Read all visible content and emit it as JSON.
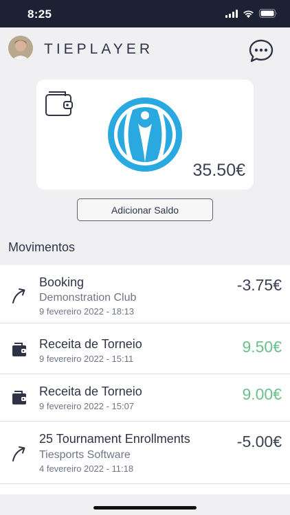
{
  "status_bar": {
    "time": "8:25"
  },
  "header": {
    "title": "TIEPLAYER"
  },
  "wallet": {
    "balance": "35.50€"
  },
  "add_balance_label": "Adicionar Saldo",
  "section_title": "Movimentos",
  "transactions": [
    {
      "icon": "arrow-up-right-icon",
      "title": "Booking",
      "subtitle": "Demonstration Club",
      "date": "9 fevereiro 2022 - 18:13",
      "amount": "-3.75€",
      "color": "#3a4152"
    },
    {
      "icon": "wallet-icon",
      "title": "Receita de Torneio",
      "subtitle": "",
      "date": "9 fevereiro 2022 - 15:11",
      "amount": "9.50€",
      "color": "#6cc08d"
    },
    {
      "icon": "wallet-icon",
      "title": "Receita de Torneio",
      "subtitle": "",
      "date": "9 fevereiro 2022 - 15:07",
      "amount": "9.00€",
      "color": "#6cc08d"
    },
    {
      "icon": "arrow-up-right-icon",
      "title": "25 Tournament Enrollments",
      "subtitle": "Tiesports Software",
      "date": "4 fevereiro 2022 - 11:18",
      "amount": "-5.00€",
      "color": "#3a4152"
    }
  ],
  "colors": {
    "status_bar": "#1c2233",
    "positive": "#6cc08d",
    "brand_blue": "#29a9e0"
  }
}
